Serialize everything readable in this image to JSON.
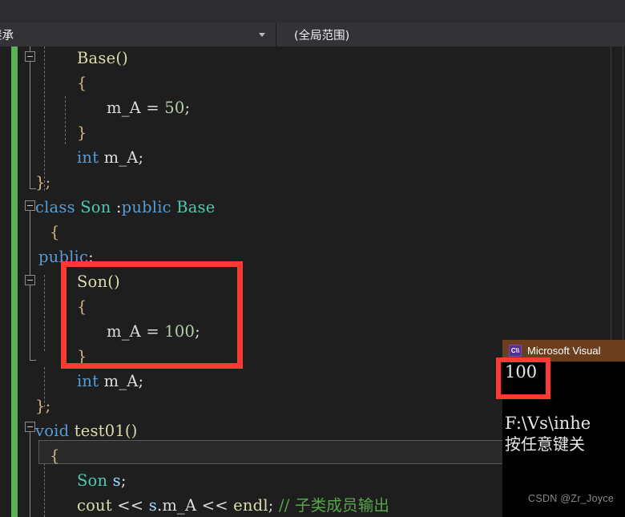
{
  "navbar": {
    "scope_left": "继承",
    "scope_right": "(全局范围)",
    "dropdown_icon": "chevron-down-icon"
  },
  "editor": {
    "language": "cpp",
    "lines": [
      {
        "indent": 0,
        "tokens": [
          {
            "t": "Base",
            "c": "fn"
          },
          {
            "t": "()",
            "c": "fn"
          }
        ]
      },
      {
        "indent": 0,
        "tokens": [
          {
            "t": "{",
            "c": "brace"
          }
        ]
      },
      {
        "indent": 0,
        "tokens": [
          {
            "t": "m_A",
            "c": "pun"
          },
          {
            "t": " = ",
            "c": "pun"
          },
          {
            "t": "50",
            "c": "num"
          },
          {
            "t": ";",
            "c": "pun"
          }
        ]
      },
      {
        "indent": 0,
        "tokens": [
          {
            "t": "}",
            "c": "brace"
          }
        ]
      },
      {
        "indent": 0,
        "tokens": [
          {
            "t": "int",
            "c": "kw"
          },
          {
            "t": " m_A;",
            "c": "pun"
          }
        ]
      },
      {
        "indent": 0,
        "tokens": [
          {
            "t": "};",
            "c": "brace"
          }
        ]
      },
      {
        "indent": 0,
        "tokens": [
          {
            "t": "class",
            "c": "kw"
          },
          {
            "t": " ",
            "c": "pun"
          },
          {
            "t": "Son",
            "c": "type"
          },
          {
            "t": " :",
            "c": "pun"
          },
          {
            "t": "public",
            "c": "kw"
          },
          {
            "t": " ",
            "c": "pun"
          },
          {
            "t": "Base",
            "c": "type"
          }
        ]
      },
      {
        "indent": 0,
        "tokens": [
          {
            "t": "{",
            "c": "brace"
          }
        ]
      },
      {
        "indent": 0,
        "tokens": [
          {
            "t": "public",
            "c": "kw"
          },
          {
            "t": ":",
            "c": "pun"
          }
        ]
      },
      {
        "indent": 0,
        "tokens": [
          {
            "t": "Son",
            "c": "fn"
          },
          {
            "t": "()",
            "c": "fn"
          }
        ]
      },
      {
        "indent": 0,
        "tokens": [
          {
            "t": "{",
            "c": "brace"
          }
        ]
      },
      {
        "indent": 0,
        "tokens": [
          {
            "t": "m_A",
            "c": "pun"
          },
          {
            "t": " = ",
            "c": "pun"
          },
          {
            "t": "100",
            "c": "num"
          },
          {
            "t": ";",
            "c": "pun"
          }
        ]
      },
      {
        "indent": 0,
        "tokens": [
          {
            "t": "}",
            "c": "brace"
          }
        ]
      },
      {
        "indent": 0,
        "tokens": [
          {
            "t": "int",
            "c": "kw"
          },
          {
            "t": " m_A;",
            "c": "pun"
          }
        ]
      },
      {
        "indent": 0,
        "tokens": [
          {
            "t": "};",
            "c": "brace"
          }
        ]
      },
      {
        "indent": 0,
        "tokens": [
          {
            "t": "void",
            "c": "kw"
          },
          {
            "t": " ",
            "c": "pun"
          },
          {
            "t": "test01",
            "c": "fn"
          },
          {
            "t": "()",
            "c": "fn"
          }
        ]
      },
      {
        "indent": 0,
        "tokens": [
          {
            "t": "{",
            "c": "brace"
          }
        ]
      },
      {
        "indent": 0,
        "tokens": [
          {
            "t": "Son",
            "c": "type"
          },
          {
            "t": " ",
            "c": "pun"
          },
          {
            "t": "s",
            "c": "var"
          },
          {
            "t": ";",
            "c": "pun"
          }
        ]
      },
      {
        "indent": 0,
        "tokens": [
          {
            "t": "cout",
            "c": "fn"
          },
          {
            "t": " << ",
            "c": "pun"
          },
          {
            "t": "s",
            "c": "var"
          },
          {
            "t": ".",
            "c": "pun"
          },
          {
            "t": "m_A",
            "c": "pun"
          },
          {
            "t": " << ",
            "c": "pun"
          },
          {
            "t": "endl",
            "c": "fn"
          },
          {
            "t": "; ",
            "c": "pun"
          },
          {
            "t": "// 子类成员输出",
            "c": "cmt"
          }
        ]
      }
    ]
  },
  "annotations": {
    "highlight_code_label": "son-constructor-highlight",
    "highlight_output_label": "console-output-highlight",
    "color": "#fb3b33"
  },
  "console": {
    "title": "Microsoft Visual",
    "icon": "visual-studio-console-icon",
    "output_value": "100",
    "path_line": "F:\\Vs\\inhe",
    "prompt_line": "按任意键关"
  },
  "watermark": {
    "text": "CSDN @Zr_Joyce"
  }
}
